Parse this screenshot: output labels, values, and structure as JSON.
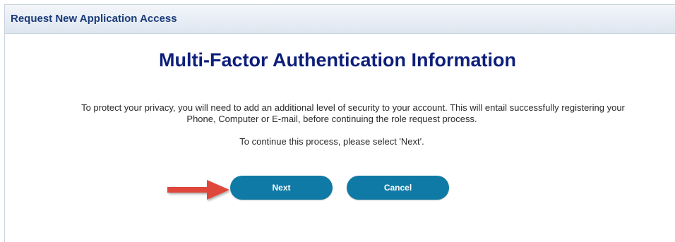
{
  "header": {
    "title": "Request New Application Access"
  },
  "main": {
    "heading": "Multi-Factor Authentication Information",
    "paragraph_line1": "To protect your privacy, you will need to add an additional level of security to your account. This will entail successfully registering your",
    "paragraph_line2": "Phone, Computer or E-mail, before continuing the role request process.",
    "instruction": "To continue this process, please select 'Next'."
  },
  "buttons": {
    "next": "Next",
    "cancel": "Cancel"
  },
  "colors": {
    "button": "#0f7aa5",
    "heading": "#0d1f7a",
    "header_text": "#1b3a78",
    "arrow": "#e0473a"
  },
  "icons": {
    "pointer": "red-arrow-icon"
  }
}
